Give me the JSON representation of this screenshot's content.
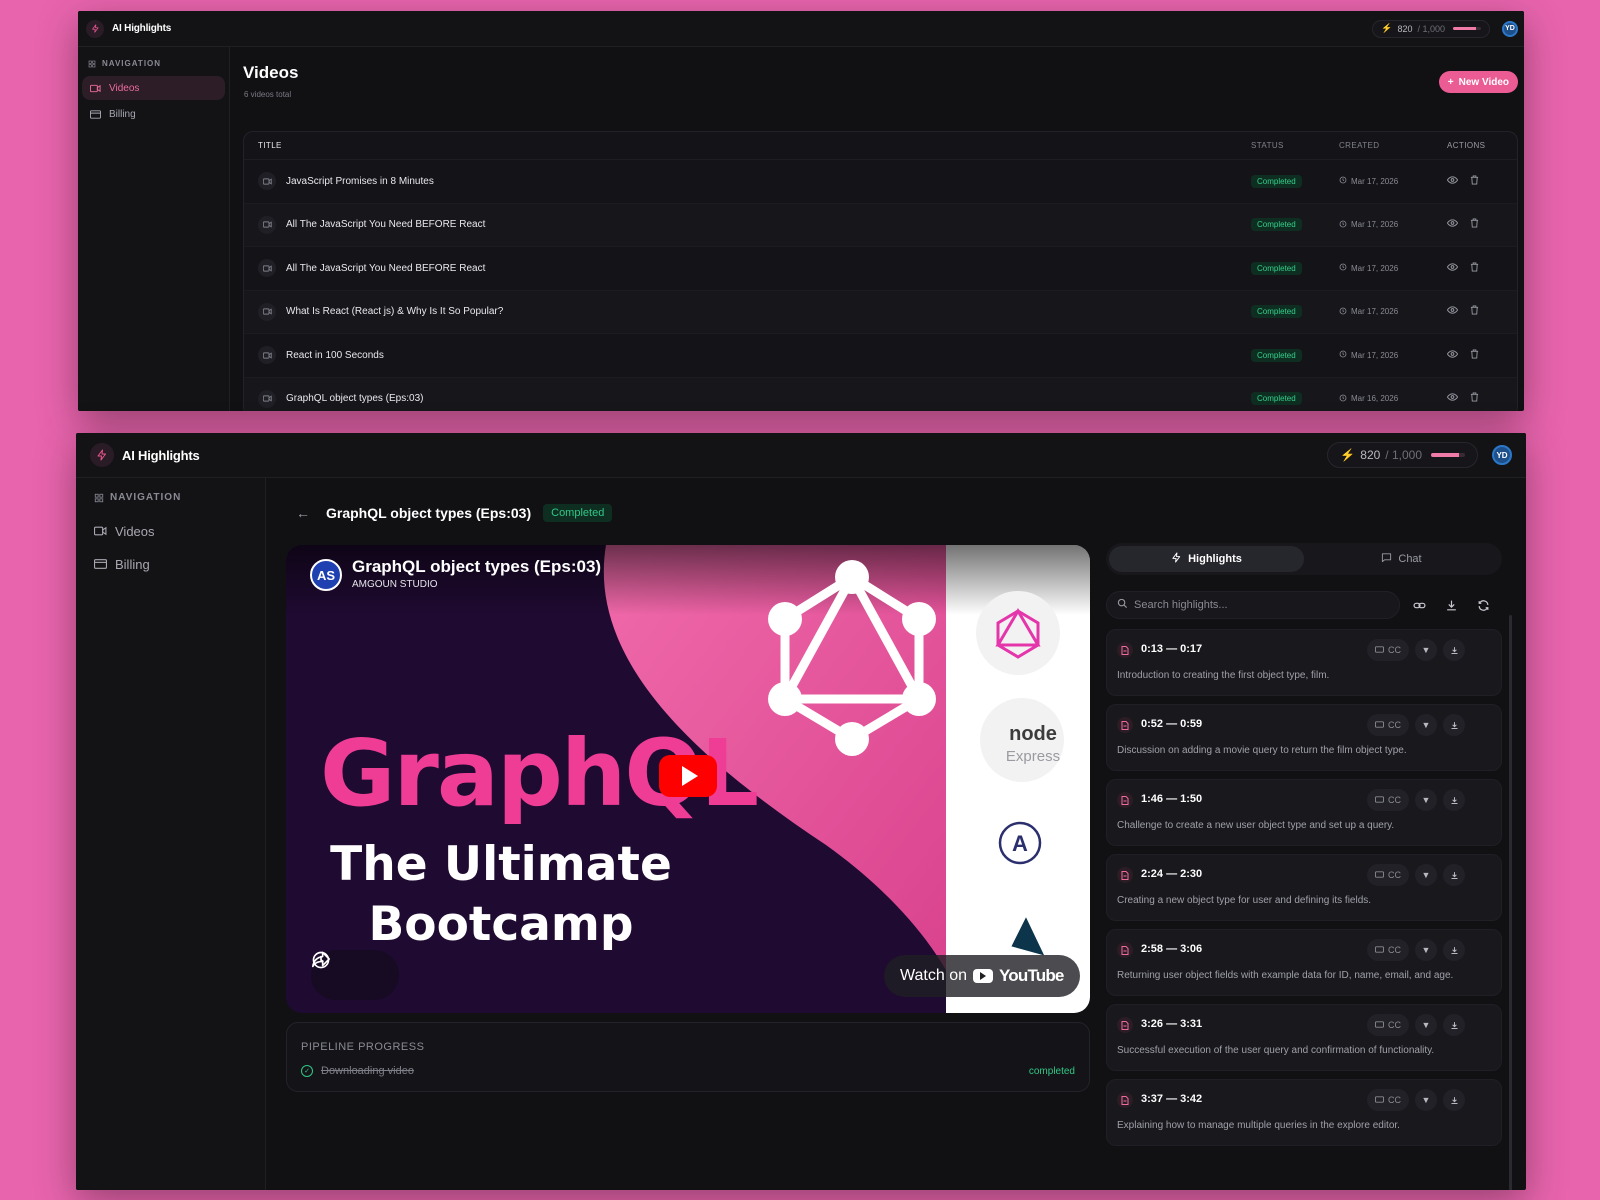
{
  "app": {
    "name": "AI Highlights",
    "credits_used": "820",
    "credits_max": "/ 1,000",
    "credits_fraction": 0.82,
    "avatar_initials": "YD",
    "accent": "#ec5c94"
  },
  "sidebar": {
    "heading": "NAVIGATION",
    "items": [
      {
        "label": "Videos",
        "icon": "video-icon"
      },
      {
        "label": "Billing",
        "icon": "card-icon"
      }
    ]
  },
  "videos_page": {
    "title": "Videos",
    "subtitle": "6 videos total",
    "new_button": "New Video",
    "columns": {
      "title": "TITLE",
      "status": "STATUS",
      "created": "CREATED",
      "actions": "ACTIONS"
    },
    "rows": [
      {
        "title": "JavaScript Promises in 8 Minutes",
        "status": "Completed",
        "created": "Mar 17, 2026"
      },
      {
        "title": "All The JavaScript You Need BEFORE React",
        "status": "Completed",
        "created": "Mar 17, 2026"
      },
      {
        "title": "All The JavaScript You Need BEFORE React",
        "status": "Completed",
        "created": "Mar 17, 2026"
      },
      {
        "title": "What Is React (React js) & Why Is It So Popular?",
        "status": "Completed",
        "created": "Mar 17, 2026"
      },
      {
        "title": "React in 100 Seconds",
        "status": "Completed",
        "created": "Mar 17, 2026"
      },
      {
        "title": "GraphQL object types (Eps:03)",
        "status": "Completed",
        "created": "Mar 16, 2026"
      }
    ]
  },
  "detail": {
    "title": "GraphQL object types (Eps:03)",
    "status": "Completed",
    "video": {
      "channel_initials": "AS",
      "title": "GraphQL object types (Eps:03)",
      "channel": "AMGOUN STUDIO",
      "big_text": "GraphQL",
      "line1": "The Ultimate",
      "line2": "Bootcamp",
      "node_text": "node",
      "express_text": "Express",
      "watch_prefix": "Watch on",
      "watch_brand": "YouTube"
    },
    "pipeline": {
      "label": "PIPELINE PROGRESS",
      "step": "Downloading video",
      "step_status": "completed"
    },
    "tabs": {
      "highlights": "Highlights",
      "chat": "Chat"
    },
    "search_placeholder": "Search highlights...",
    "cc_label": "CC",
    "highlights": [
      {
        "time": "0:13 — 0:17",
        "desc": "Introduction to creating the first object type, film."
      },
      {
        "time": "0:52 — 0:59",
        "desc": "Discussion on adding a movie query to return the film object type."
      },
      {
        "time": "1:46 — 1:50",
        "desc": "Challenge to create a new user object type and set up a query."
      },
      {
        "time": "2:24 — 2:30",
        "desc": "Creating a new object type for user and defining its fields."
      },
      {
        "time": "2:58 — 3:06",
        "desc": "Returning user object fields with example data for ID, name, email, and age."
      },
      {
        "time": "3:26 — 3:31",
        "desc": "Successful execution of the user query and confirmation of functionality."
      },
      {
        "time": "3:37 — 3:42",
        "desc": "Explaining how to manage multiple queries in the explore editor."
      }
    ]
  }
}
